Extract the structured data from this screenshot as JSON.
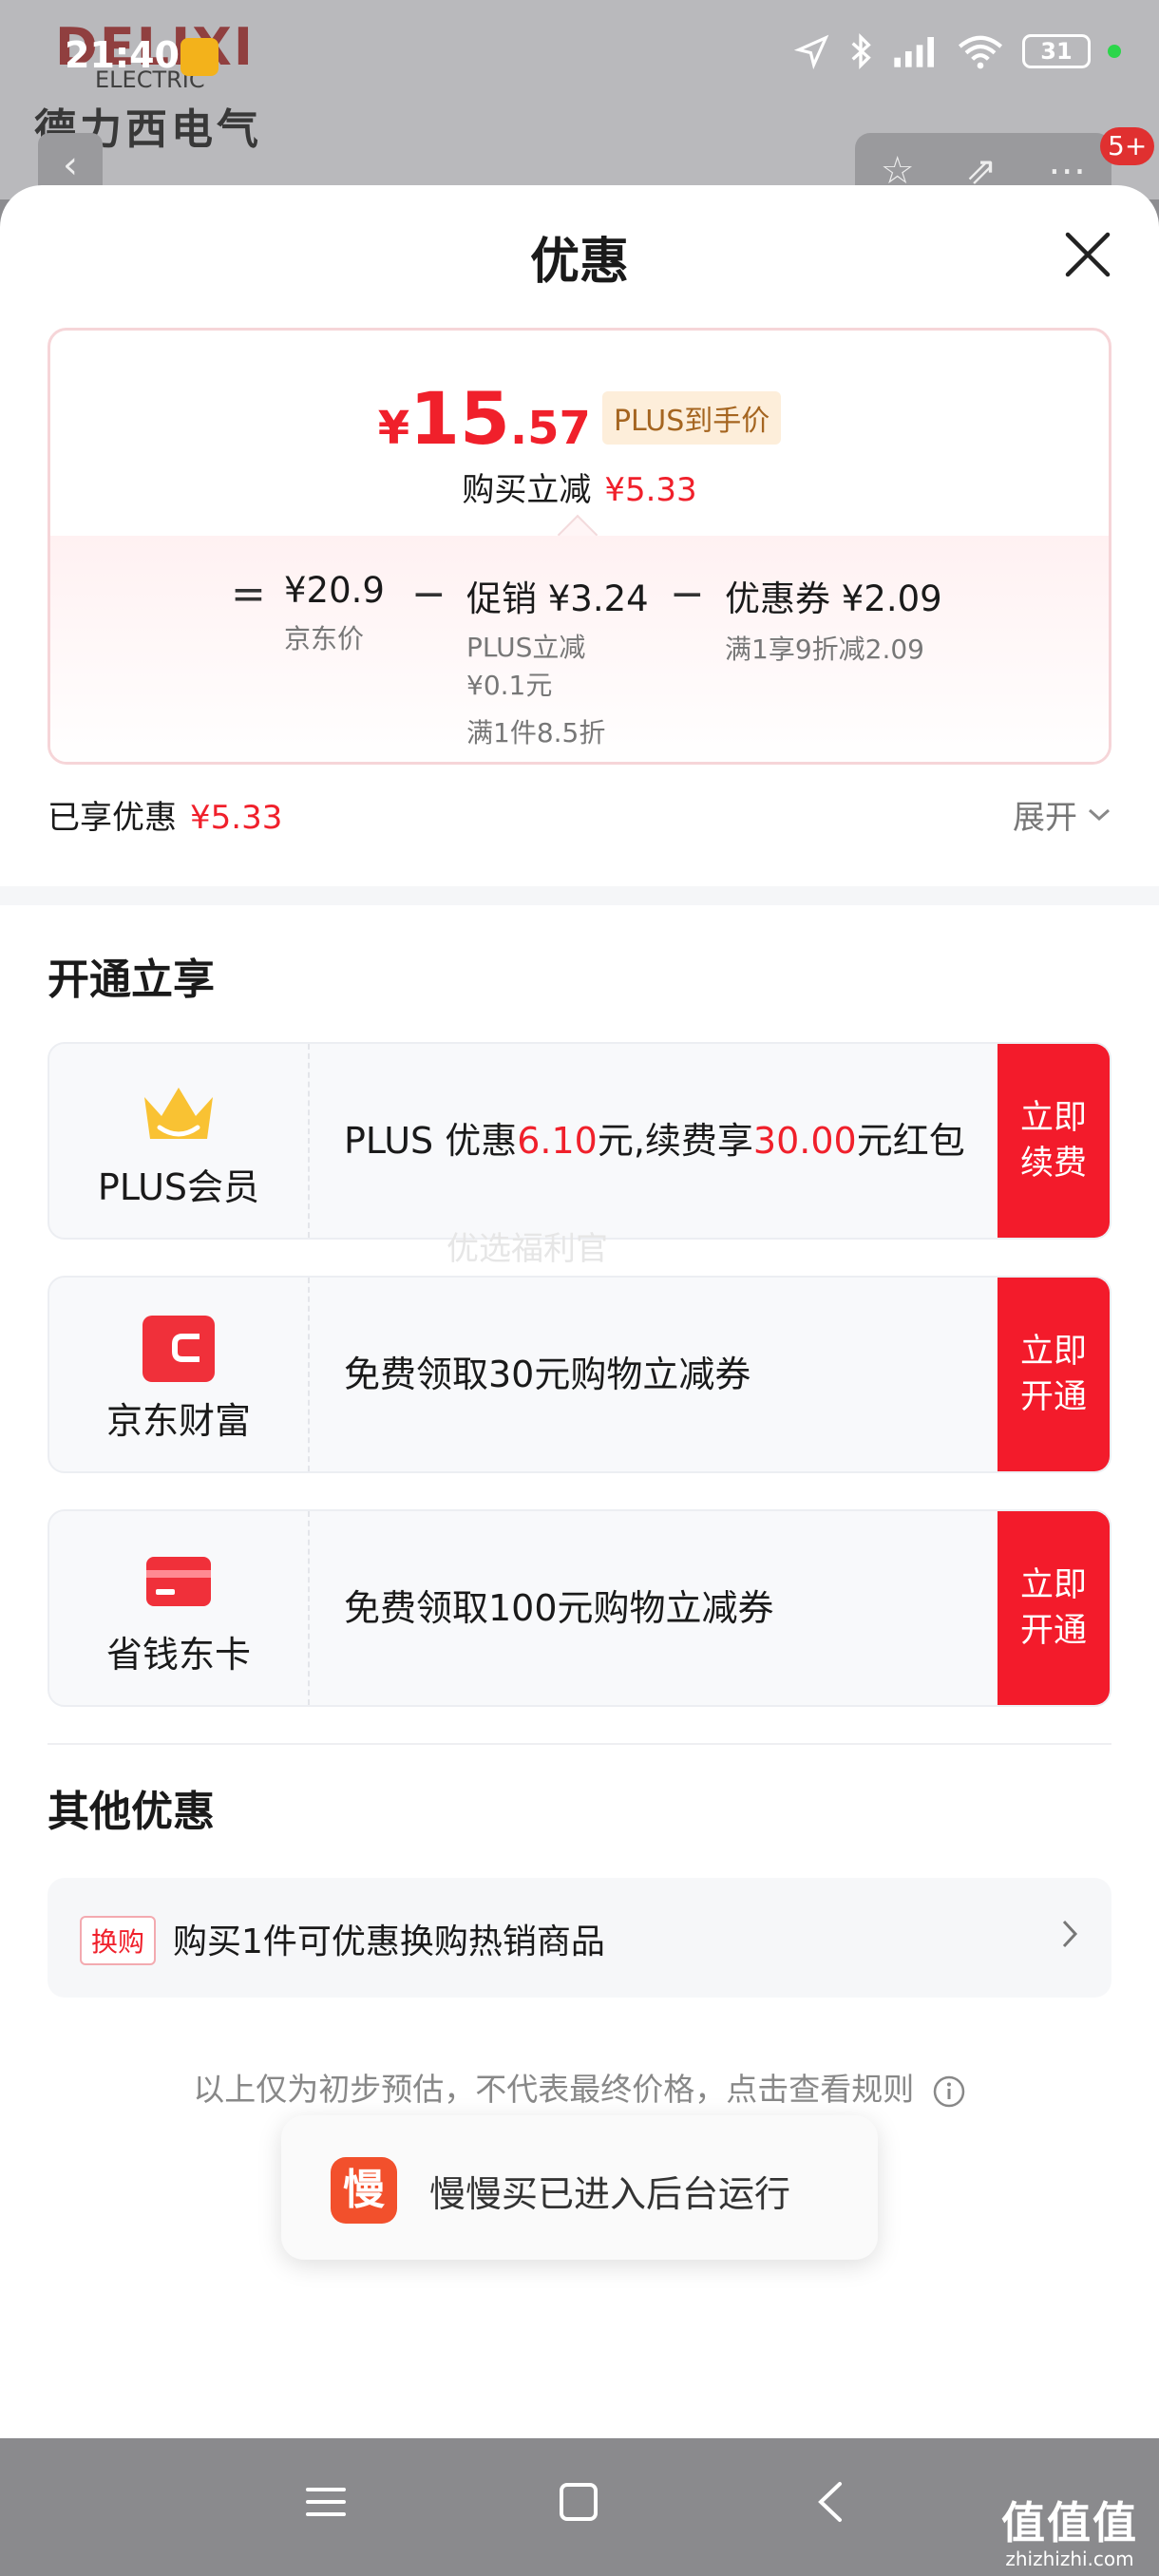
{
  "background": {
    "brand_en": "DELIXI",
    "brand_sub": "ELECTRIC",
    "brand_cn": "德力西电气",
    "badge": "5+"
  },
  "status_bar": {
    "time": "21:40",
    "battery": "31"
  },
  "sheet": {
    "title": "优惠",
    "price": {
      "symbol": "¥",
      "integer": "15",
      "decimal": ".57",
      "tag": "PLUS到手价",
      "reduce_label": "购买立减",
      "reduce_value": "¥5.33"
    },
    "calc": {
      "equals": "=",
      "minus": "−",
      "items": [
        {
          "value": "¥20.9",
          "label": "京东价"
        },
        {
          "value": "促销 ¥3.24",
          "label": "PLUS立减",
          "label2": "¥0.1元",
          "label3": "满1件8.5折"
        },
        {
          "value": "优惠券 ¥2.09",
          "label": "满1享9折减2.09"
        }
      ]
    },
    "enjoyed_label": "已享优惠",
    "enjoyed_value": "¥5.33",
    "expand_label": "展开",
    "open_section_title": "开通立享",
    "offers": [
      {
        "name": "PLUS会员",
        "desc_parts": [
          "PLUS 优惠",
          "6.10",
          "元,续费享",
          "30.00",
          "元红包"
        ],
        "button": "立即续费"
      },
      {
        "name": "京东财富",
        "desc": "免费领取30元购物立减券",
        "button": "立即开通"
      },
      {
        "name": "省钱东卡",
        "desc": "免费领取100元购物立减券",
        "button": "立即开通"
      }
    ],
    "watermark": "优选福利官",
    "other_section_title": "其他优惠",
    "trade": {
      "tag": "换购",
      "text": "购买1件可优惠换购热销商品"
    },
    "disclaimer": "以上仅为初步预估，不代表最终价格，点击查看规则",
    "toast": {
      "icon_char": "慢",
      "text": "慢慢买已进入后台运行"
    }
  },
  "site_watermark": {
    "big": "值值值",
    "small": "zhizhizhi.com"
  },
  "colors": {
    "accent_red": "#f0202b",
    "button_red": "#f31b2b",
    "plus_gold": "#a56520"
  }
}
